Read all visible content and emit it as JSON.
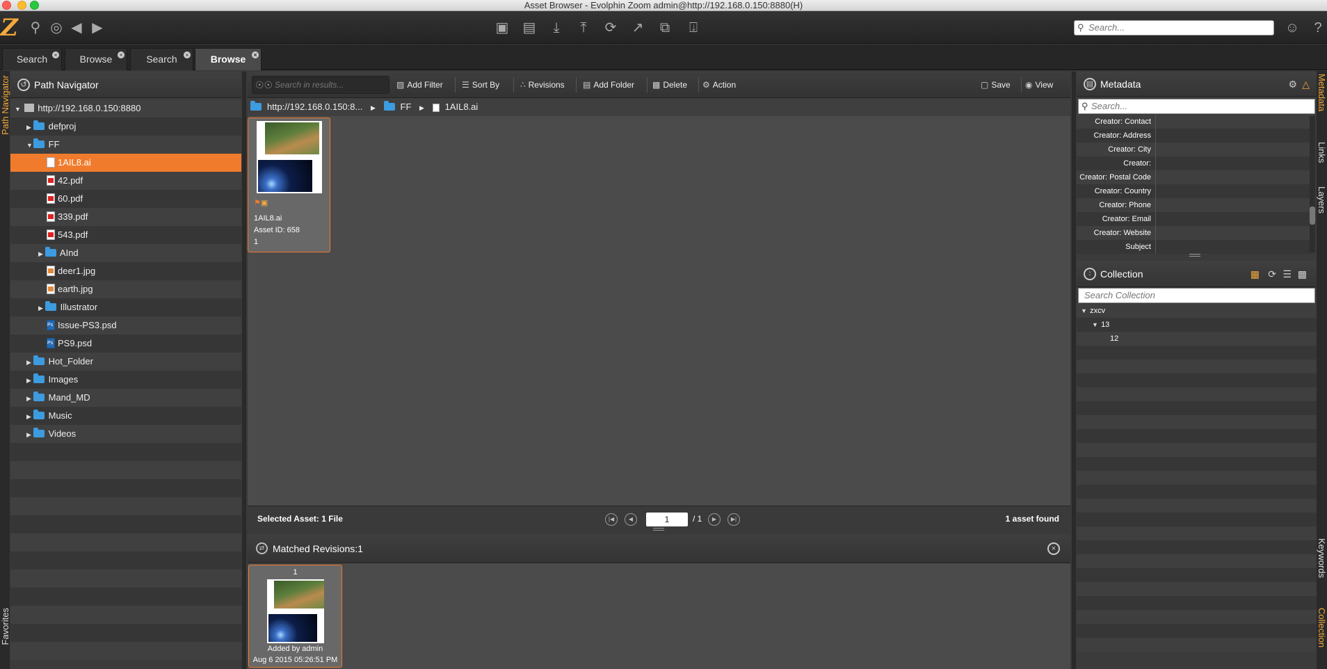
{
  "window": {
    "title": "Asset Browser - Evolphin Zoom admin@http://192.168.0.150:8880(H)"
  },
  "toolbar": {
    "logo": "Z",
    "left_icons": [
      "search-icon",
      "globe-icon",
      "back-arrow-icon",
      "forward-arrow-icon"
    ],
    "center_icons": [
      "lock-icon",
      "unlock-icon",
      "download-icon",
      "upload-icon",
      "sync-icon",
      "share-icon",
      "copy-icon",
      "cart-icon"
    ],
    "search_placeholder": "Search...",
    "right_icons": [
      "user-icon",
      "help-icon"
    ]
  },
  "tabs": [
    {
      "label": "Search",
      "active": false
    },
    {
      "label": "Browse",
      "active": false
    },
    {
      "label": "Search",
      "active": false
    },
    {
      "label": "Browse",
      "active": true
    }
  ],
  "side_left": {
    "top_label": "Path Navigator",
    "bottom_label": "Favorites"
  },
  "path_navigator": {
    "title": "Path Navigator",
    "root": "http://192.168.0.150:8880",
    "items": [
      {
        "label": "defproj",
        "type": "folder",
        "level": 1,
        "expanded": false
      },
      {
        "label": "FF",
        "type": "folder",
        "level": 1,
        "expanded": true
      },
      {
        "label": "1AIL8.ai",
        "type": "ai",
        "level": 2,
        "selected": true
      },
      {
        "label": "42.pdf",
        "type": "pdf",
        "level": 2
      },
      {
        "label": "60.pdf",
        "type": "pdf",
        "level": 2
      },
      {
        "label": "339.pdf",
        "type": "pdf",
        "level": 2
      },
      {
        "label": "543.pdf",
        "type": "pdf",
        "level": 2
      },
      {
        "label": "AInd",
        "type": "folder",
        "level": 2,
        "expanded": false
      },
      {
        "label": "deer1.jpg",
        "type": "jpg",
        "level": 2
      },
      {
        "label": "earth.jpg",
        "type": "jpg",
        "level": 2
      },
      {
        "label": "Illustrator",
        "type": "folder",
        "level": 2,
        "expanded": false
      },
      {
        "label": "Issue-PS3.psd",
        "type": "psd",
        "level": 2
      },
      {
        "label": "PS9.psd",
        "type": "psd",
        "level": 2
      },
      {
        "label": "Hot_Folder",
        "type": "folder",
        "level": 1,
        "expanded": false
      },
      {
        "label": "Images",
        "type": "folder",
        "level": 1,
        "expanded": false
      },
      {
        "label": "Mand_MD",
        "type": "folder",
        "level": 1,
        "expanded": false
      },
      {
        "label": "Music",
        "type": "folder",
        "level": 1,
        "expanded": false
      },
      {
        "label": "Videos",
        "type": "folder",
        "level": 1,
        "expanded": false
      }
    ]
  },
  "center_toolbar": {
    "search_placeholder": "Search in results...",
    "buttons": {
      "add_filter": "Add Filter",
      "sort_by": "Sort By",
      "revisions": "Revisions",
      "add_folder": "Add Folder",
      "delete": "Delete",
      "action": "Action",
      "save": "Save",
      "view": "View"
    }
  },
  "breadcrumb": [
    "http://192.168.0.150:8...",
    "FF",
    "1AIL8.ai"
  ],
  "asset_card": {
    "name": "1AIL8.ai",
    "asset_id": "Asset ID: 658",
    "version": "1"
  },
  "status": {
    "selected": "Selected Asset: 1 File",
    "page": "1",
    "page_total": "/ 1",
    "found": "1 asset found"
  },
  "revisions": {
    "title": "Matched Revisions:1",
    "card": {
      "number": "1",
      "added_by": "Added by admin",
      "date": "Aug 6 2015 05:26:51 PM"
    }
  },
  "metadata": {
    "title": "Metadata",
    "search_placeholder": "Search...",
    "fields": [
      "Creator: Contact",
      "Creator: Address",
      "Creator: City",
      "Creator:",
      "Creator: Postal Code",
      "Creator: Country",
      "Creator: Phone",
      "Creator: Email",
      "Creator: Website",
      "Subject"
    ]
  },
  "collection": {
    "title": "Collection",
    "search_placeholder": "Search Collection",
    "items": [
      {
        "label": "zxcv",
        "level": 0
      },
      {
        "label": "13",
        "level": 1
      },
      {
        "label": "12",
        "level": 2
      }
    ]
  },
  "side_right": {
    "labels": [
      "Metadata",
      "Links",
      "Layers",
      "Keywords",
      "Collection"
    ]
  },
  "colors": {
    "accent": "#f07b2c",
    "folder": "#3d9be0"
  }
}
